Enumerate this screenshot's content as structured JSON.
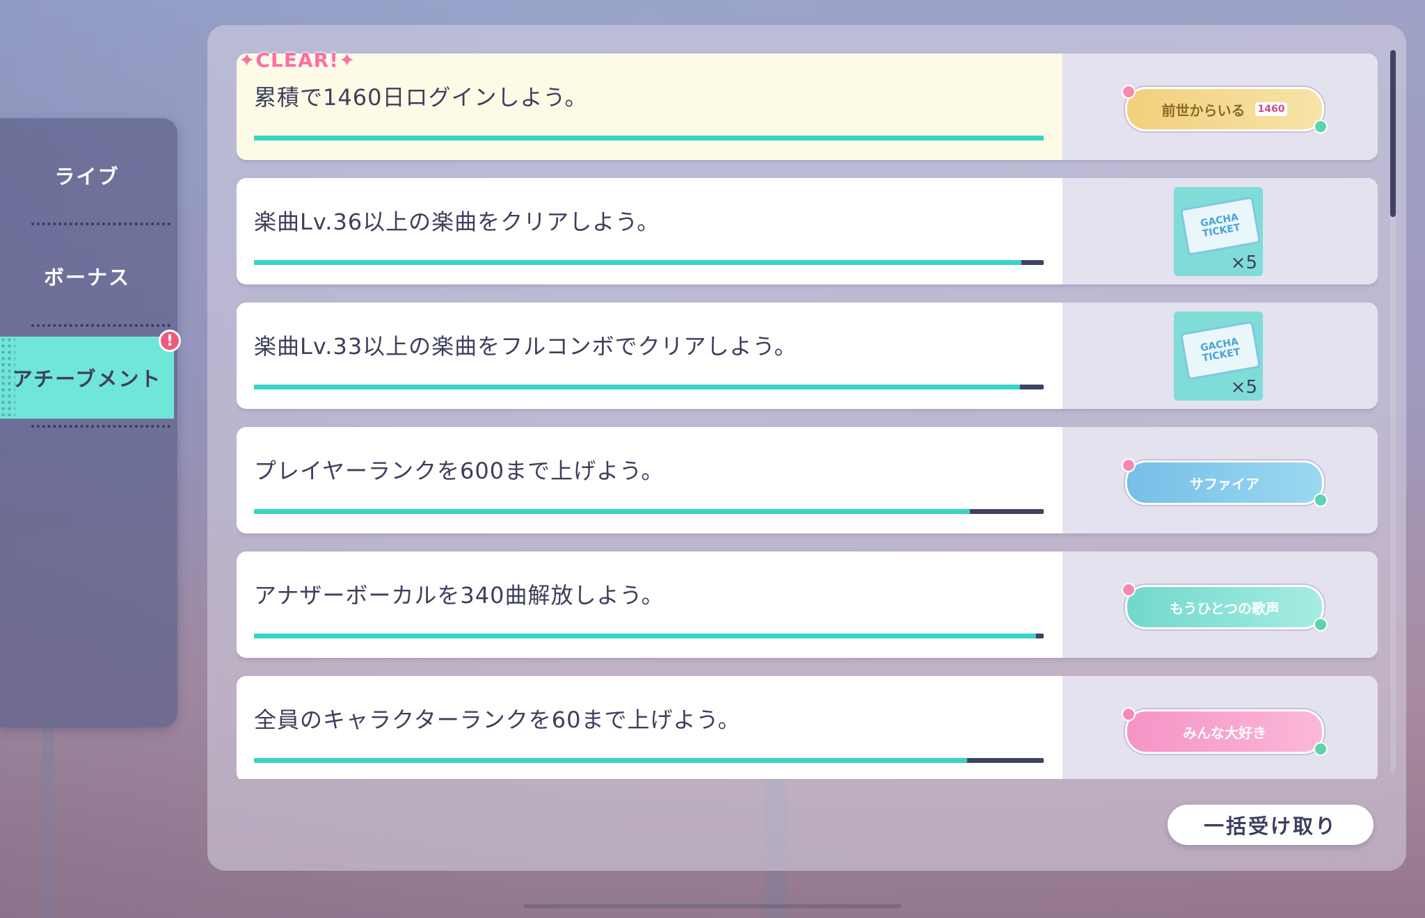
{
  "sidebar": {
    "items": [
      {
        "label": "ライブ",
        "active": false
      },
      {
        "label": "ボーナス",
        "active": false
      },
      {
        "label": "アチーブメント",
        "active": true
      }
    ],
    "alert_badge": "!"
  },
  "clear_label": "✦CLEAR!✦",
  "missions": [
    {
      "title": "累積で1460日ログインしよう。",
      "progress": 1.0,
      "cleared": true,
      "reward": {
        "type": "banner",
        "label": "前世からいる",
        "extra": "1460"
      }
    },
    {
      "title": "楽曲Lv.36以上の楽曲をクリアしよう。",
      "progress": 0.972,
      "cleared": false,
      "reward": {
        "type": "ticket",
        "card_line1": "GACHA",
        "card_line2": "TICKET",
        "count": "×5"
      }
    },
    {
      "title": "楽曲Lv.33以上の楽曲をフルコンボでクリアしよう。",
      "progress": 0.97,
      "cleared": false,
      "reward": {
        "type": "ticket",
        "card_line1": "GACHA",
        "card_line2": "TICKET",
        "count": "×5"
      }
    },
    {
      "title": "プレイヤーランクを600まで上げよう。",
      "progress": 0.907,
      "cleared": false,
      "reward": {
        "type": "banner",
        "label": "サファイア"
      }
    },
    {
      "title": "アナザーボーカルを340曲解放しよう。",
      "progress": 0.99,
      "cleared": false,
      "reward": {
        "type": "banner",
        "label": "もうひとつの歌声"
      }
    },
    {
      "title": "全員のキャラクターランクを60まで上げよう。",
      "progress": 0.903,
      "cleared": false,
      "reward": {
        "type": "banner",
        "label": "みんな大好き"
      }
    }
  ],
  "claim_all_label": "一括受け取り",
  "colors": {
    "accent": "#37d4c6",
    "bar_track": "#3f4260",
    "text": "#3d3e5c",
    "clear": "#ff6f9e"
  }
}
